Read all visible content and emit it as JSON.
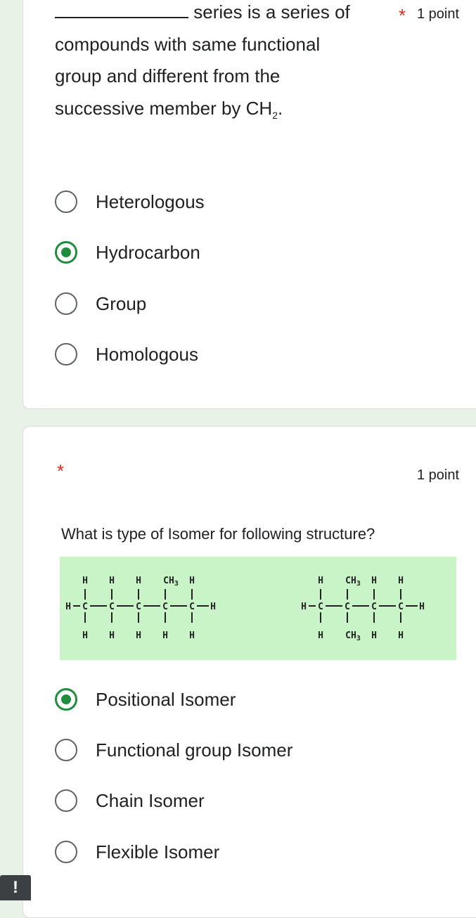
{
  "question1": {
    "blank": "_____________",
    "line1_rest": "series is a series of",
    "line2": "compounds with same functional",
    "line3": "group and different from the",
    "line4_text": "successive member by CH",
    "line4_sub": "2",
    "line4_end": ".",
    "required_mark": "*",
    "points": "1 point",
    "options": [
      {
        "label": "Heterologous",
        "selected": false
      },
      {
        "label": "Hydrocarbon",
        "selected": true
      },
      {
        "label": "Group",
        "selected": false
      },
      {
        "label": "Homologous",
        "selected": false
      }
    ]
  },
  "question2": {
    "required_mark": "*",
    "points": "1 point",
    "prompt": "What is type of Isomer for following structure?",
    "structure": {
      "H": "H",
      "C": "C",
      "CH3_base": "CH",
      "CH3_sub": "3"
    },
    "options": [
      {
        "label": "Positional Isomer",
        "selected": true
      },
      {
        "label": "Functional group Isomer",
        "selected": false
      },
      {
        "label": "Chain Isomer",
        "selected": false
      },
      {
        "label": "Flexible Isomer",
        "selected": false
      }
    ]
  },
  "alert_icon": "!",
  "colors": {
    "accent_green": "#1e8e3e",
    "required_red": "#d93025",
    "structure_bg": "#c8f4c8",
    "page_bg": "#e8f2e6"
  }
}
